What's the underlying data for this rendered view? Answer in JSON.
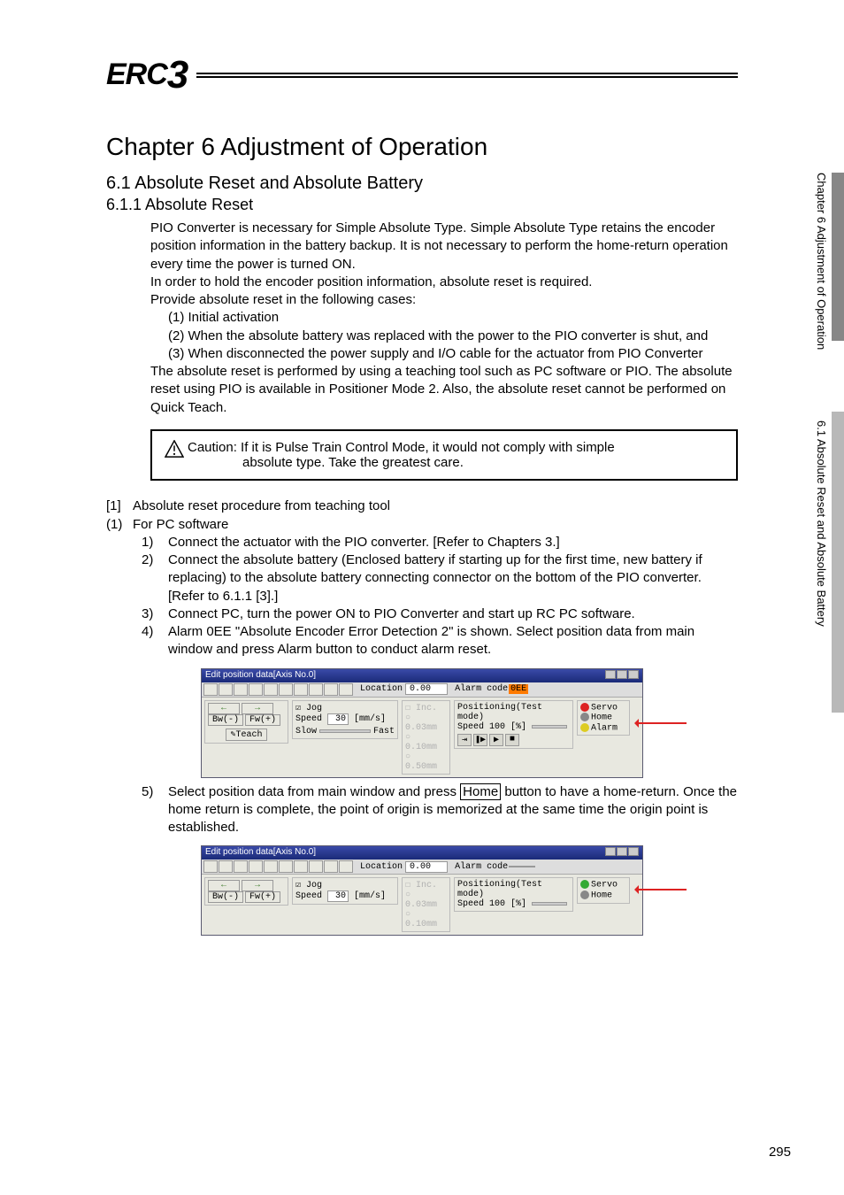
{
  "logo": {
    "brand_part1": "ERC",
    "brand_part2": "3"
  },
  "chapter_title": "Chapter 6   Adjustment of Operation",
  "section_6_1": "6.1    Absolute Reset and Absolute Battery",
  "section_6_1_1": "6.1.1    Absolute Reset",
  "intro_p1": "PIO Converter is necessary for Simple Absolute Type. Simple Absolute Type retains the encoder position information in the battery backup. It is not necessary to perform the home-return operation every time the power is turned ON.",
  "intro_p2": "In order to hold the encoder position information, absolute reset is required.",
  "intro_p3": "Provide absolute reset in the following cases:",
  "cases": {
    "c1": "(1) Initial activation",
    "c2": "(2) When the absolute battery was replaced with the power to the PIO converter is shut, and",
    "c3": "(3) When disconnected the power supply and I/O cable for the actuator from PIO Converter"
  },
  "intro_p4": "The absolute reset is performed by using a teaching tool such as PC software or PIO. The absolute reset using PIO is available in Positioner Mode 2. Also, the absolute reset cannot be performed on Quick Teach.",
  "caution": {
    "line1": "Caution: If it is Pulse Train Control Mode, it would not comply with simple",
    "line2": "absolute type. Take the greatest care."
  },
  "sec1_title": "Absolute reset procedure from teaching tool",
  "sec1_sub": "For PC software",
  "steps": {
    "s1": "Connect the actuator with the PIO converter. [Refer to Chapters 3.]",
    "s2": "Connect the absolute battery (Enclosed battery if starting up for the first time, new battery if replacing) to the absolute battery connecting connector on the bottom of the PIO converter. [Refer to 6.1.1 [3].]",
    "s3": "Connect PC, turn the power ON to PIO Converter and start up RC PC software.",
    "s4": "Alarm 0EE \"Absolute Encoder Error Detection 2\" is shown. Select position data from main window and press Alarm button to conduct alarm reset.",
    "s5_pre": "Select position data from main window and press ",
    "s5_home": "Home",
    "s5_post": " button to have a home-return. Once the home return is complete, the point of origin is memorized at the same time the origin point is established."
  },
  "shot": {
    "title": "Edit position data[Axis No.0]",
    "loc_lbl": "Location",
    "loc_val": "0.00",
    "alarm_lbl": "Alarm code",
    "alarm_on": "0EE",
    "jog": "Jog",
    "speed_lbl": "Speed",
    "speed_val": "30",
    "speed_unit": "[mm/s]",
    "bw": "Bw(-)",
    "fw": "Fw(+)",
    "teach": "Teach",
    "slow": "Slow",
    "fast": "Fast",
    "inc": "Inc.",
    "inc_v1": "0.03mm",
    "inc_v2": "0.10mm",
    "inc_v3": "0.50mm",
    "pos_mode": "Positioning(Test mode)",
    "spd100": "Speed 100 [%]",
    "servo": "Servo",
    "home": "Home",
    "alarm_btn": "Alarm"
  },
  "sidebar": {
    "chap_label": "Chapter 6 Adjustment of Operation",
    "sec_label": "6.1 Absolute Reset and Absolute Battery"
  },
  "page_number": "295"
}
